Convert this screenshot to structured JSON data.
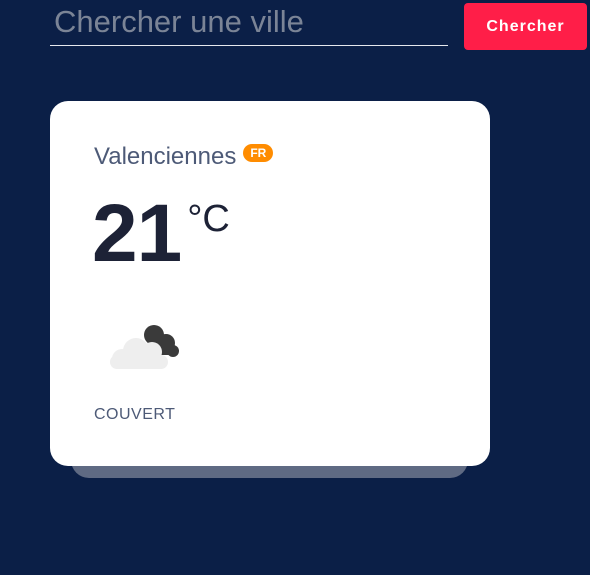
{
  "search": {
    "placeholder": "Chercher une ville",
    "value": "",
    "button_label": "Chercher"
  },
  "weather": {
    "city": "Valenciennes",
    "country_code": "FR",
    "temperature": "21",
    "unit": "°C",
    "condition": "COUVERT",
    "icon": "overcast-clouds-icon"
  },
  "colors": {
    "background": "#0b1f47",
    "accent_button": "#ff1e48",
    "badge": "#ff8c00",
    "card": "#ffffff"
  }
}
